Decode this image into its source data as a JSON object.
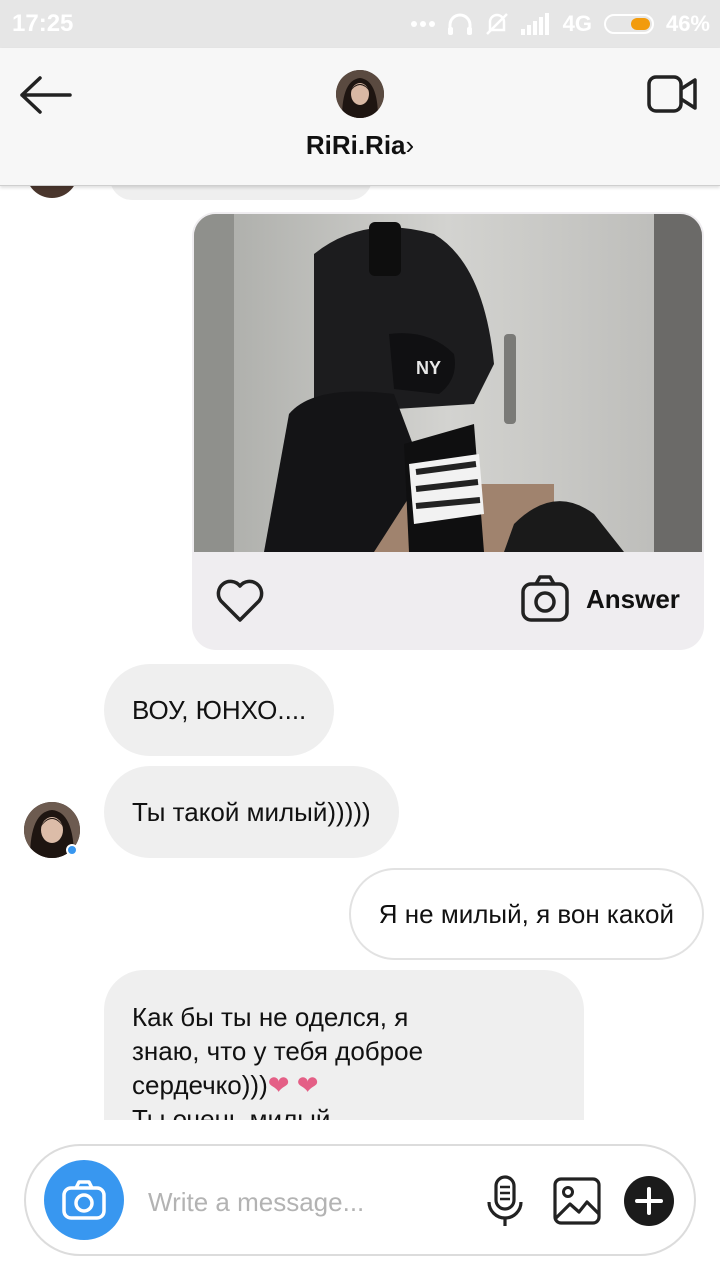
{
  "status_bar": {
    "time": "17:25",
    "network": "4G",
    "battery_percent": "46%",
    "battery_level": 0.46,
    "icons": [
      "dots-icon",
      "headphones-icon",
      "mute-icon",
      "signal-icon",
      "battery-icon"
    ]
  },
  "header": {
    "back_icon": "arrow-left-icon",
    "username": "RiRi.Ria",
    "chevron": "›",
    "video_icon": "video-camera-icon"
  },
  "photo_message": {
    "like_icon": "heart-outline-icon",
    "camera_icon": "camera-icon",
    "answer_label": "Answer"
  },
  "messages": [
    {
      "direction": "in",
      "text": "ВОУ, ЮНХО...."
    },
    {
      "direction": "in",
      "text": "Ты такой милый)))))"
    },
    {
      "direction": "out",
      "text": "Я не милый, я вон какой"
    },
    {
      "direction": "in",
      "text_lines": [
        "Как бы ты не оделся, я",
        "знаю, что у тебя доброе",
        "сердечко)))",
        "Ты очень милый"
      ],
      "hearts": "❤ ❤"
    }
  ],
  "composer": {
    "placeholder": "Write a message...",
    "icons": [
      "camera-icon",
      "microphone-icon",
      "image-icon",
      "plus-icon"
    ]
  },
  "colors": {
    "accent_blue": "#3897f0",
    "bubble_gray": "#efefef",
    "heart_pink": "#e45f86",
    "battery_orange": "#f29b0c"
  }
}
